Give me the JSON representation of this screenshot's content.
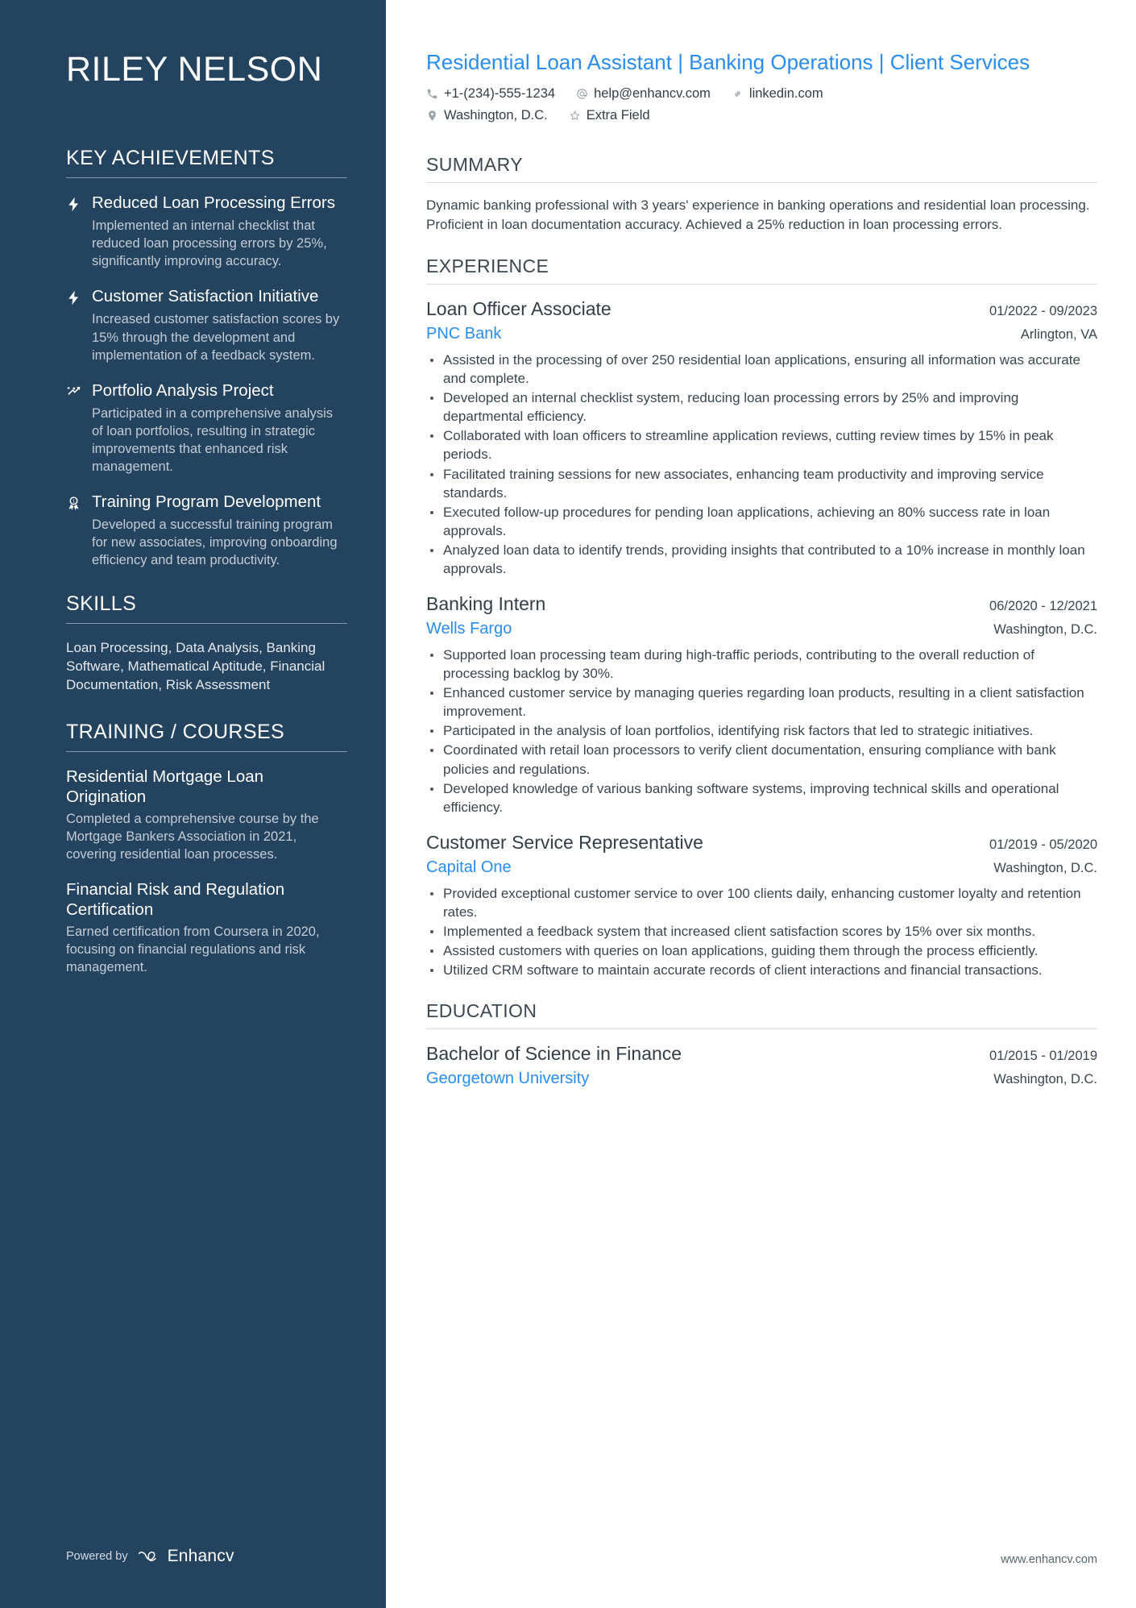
{
  "sidebar": {
    "name": "RILEY NELSON",
    "sections": {
      "achievements_heading": "KEY ACHIEVEMENTS",
      "skills_heading": "SKILLS",
      "training_heading": "TRAINING / COURSES"
    },
    "achievements": [
      {
        "icon": "lightning-bolt-icon",
        "title": "Reduced Loan Processing Errors",
        "description": "Implemented an internal checklist that reduced loan processing errors by 25%, significantly improving accuracy."
      },
      {
        "icon": "lightning-bolt-icon",
        "title": "Customer Satisfaction Initiative",
        "description": "Increased customer satisfaction scores by 15% through the development and implementation of a feedback system."
      },
      {
        "icon": "trending-arrow-icon",
        "title": "Portfolio Analysis Project",
        "description": "Participated in a comprehensive analysis of loan portfolios, resulting in strategic improvements that enhanced risk management."
      },
      {
        "icon": "award-medal-icon",
        "title": "Training Program Development",
        "description": "Developed a successful training program for new associates, improving onboarding efficiency and team productivity."
      }
    ],
    "skills_text": "Loan Processing, Data Analysis, Banking Software, Mathematical Aptitude, Financial Documentation, Risk Assessment",
    "courses": [
      {
        "title": "Residential Mortgage Loan Origination",
        "description": "Completed a comprehensive course by the Mortgage Bankers Association in 2021, covering residential loan processes."
      },
      {
        "title": "Financial Risk and Regulation Certification",
        "description": "Earned certification from Coursera in 2020, focusing on financial regulations and risk management."
      }
    ],
    "footer": {
      "powered_by": "Powered by",
      "brand": "Enhancv"
    }
  },
  "header": {
    "headline": "Residential Loan Assistant | Banking Operations | Client Services",
    "contacts_row1": [
      {
        "icon": "phone-icon",
        "text": "+1-(234)-555-1234"
      },
      {
        "icon": "at-email-icon",
        "text": "help@enhancv.com"
      },
      {
        "icon": "link-icon",
        "text": "linkedin.com"
      }
    ],
    "contacts_row2": [
      {
        "icon": "location-pin-icon",
        "text": "Washington, D.C."
      },
      {
        "icon": "star-icon",
        "text": "Extra Field"
      }
    ]
  },
  "main": {
    "summary": {
      "heading": "SUMMARY",
      "text": "Dynamic banking professional with 3 years' experience in banking operations and residential loan processing. Proficient in loan documentation accuracy. Achieved a 25% reduction in loan processing errors."
    },
    "experience": {
      "heading": "EXPERIENCE",
      "entries": [
        {
          "title": "Loan Officer Associate",
          "date": "01/2022 - 09/2023",
          "org": "PNC Bank",
          "location": "Arlington, VA",
          "bullets": [
            "Assisted in the processing of over 250 residential loan applications, ensuring all information was accurate and complete.",
            "Developed an internal checklist system, reducing loan processing errors by 25% and improving departmental efficiency.",
            "Collaborated with loan officers to streamline application reviews, cutting review times by 15% in peak periods.",
            "Facilitated training sessions for new associates, enhancing team productivity and improving service standards.",
            "Executed follow-up procedures for pending loan applications, achieving an 80% success rate in loan approvals.",
            "Analyzed loan data to identify trends, providing insights that contributed to a 10% increase in monthly loan approvals."
          ]
        },
        {
          "title": "Banking Intern",
          "date": "06/2020 - 12/2021",
          "org": "Wells Fargo",
          "location": "Washington, D.C.",
          "bullets": [
            "Supported loan processing team during high-traffic periods, contributing to the overall reduction of processing backlog by 30%.",
            "Enhanced customer service by managing queries regarding loan products, resulting in a client satisfaction improvement.",
            "Participated in the analysis of loan portfolios, identifying risk factors that led to strategic initiatives.",
            "Coordinated with retail loan processors to verify client documentation, ensuring compliance with bank policies and regulations.",
            "Developed knowledge of various banking software systems, improving technical skills and operational efficiency."
          ]
        },
        {
          "title": "Customer Service Representative",
          "date": "01/2019 - 05/2020",
          "org": "Capital One",
          "location": "Washington, D.C.",
          "bullets": [
            "Provided exceptional customer service to over 100 clients daily, enhancing customer loyalty and retention rates.",
            "Implemented a feedback system that increased client satisfaction scores by 15% over six months.",
            "Assisted customers with queries on loan applications, guiding them through the process efficiently.",
            "Utilized CRM software to maintain accurate records of client interactions and financial transactions."
          ]
        }
      ]
    },
    "education": {
      "heading": "EDUCATION",
      "entries": [
        {
          "title": "Bachelor of Science in Finance",
          "date": "01/2015 - 01/2019",
          "org": "Georgetown University",
          "location": "Washington, D.C."
        }
      ]
    },
    "footer_url": "www.enhancv.com"
  }
}
